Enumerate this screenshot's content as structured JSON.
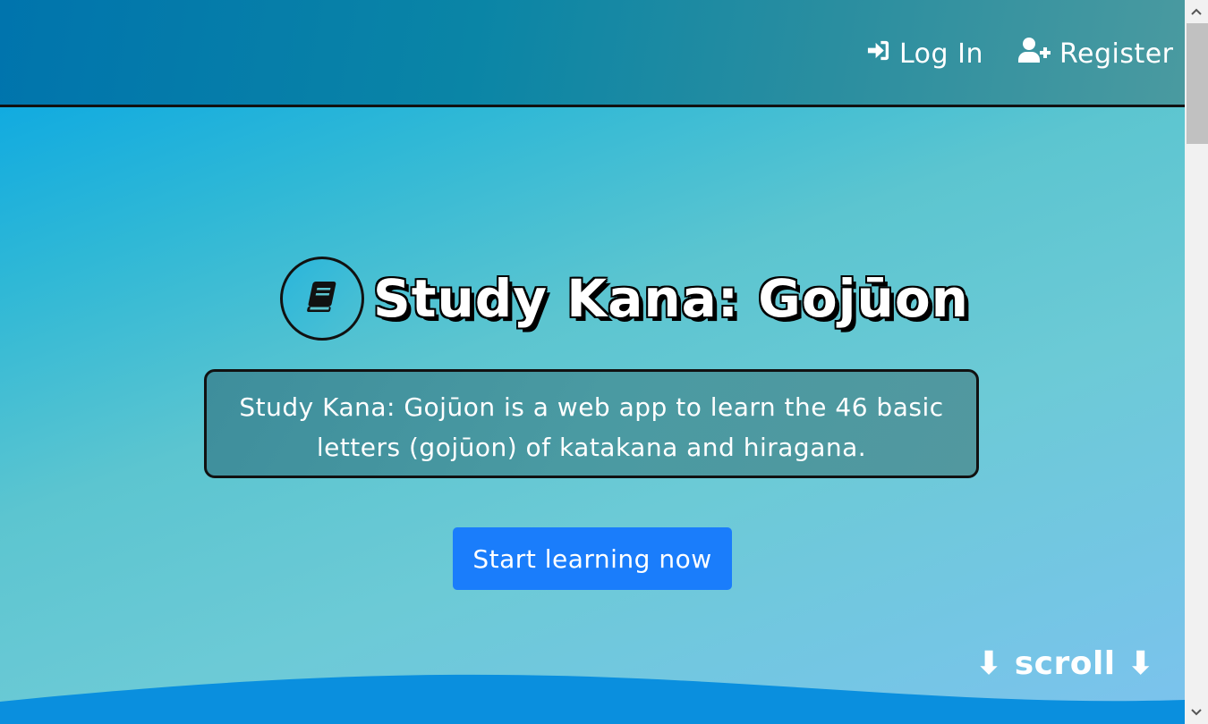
{
  "header": {
    "login_label": "Log In",
    "register_label": "Register",
    "login_icon": "sign-in-icon",
    "register_icon": "user-plus-icon"
  },
  "hero": {
    "title": "Study Kana: Gojūon",
    "title_icon": "book-icon",
    "description_line1": "Study Kana: Gojūon is a web app to learn the 46 basic",
    "description_line2": "letters (gojūon) of katakana and hiragana.",
    "cta_label": "Start learning now",
    "scroll_hint": "⬇ scroll ⬇"
  },
  "colors": {
    "cta_background": "#1a7dfb",
    "header_gradient_start": "#0074ad",
    "hero_gradient_start": "#00a3e6",
    "wave": "#0a8fde"
  }
}
